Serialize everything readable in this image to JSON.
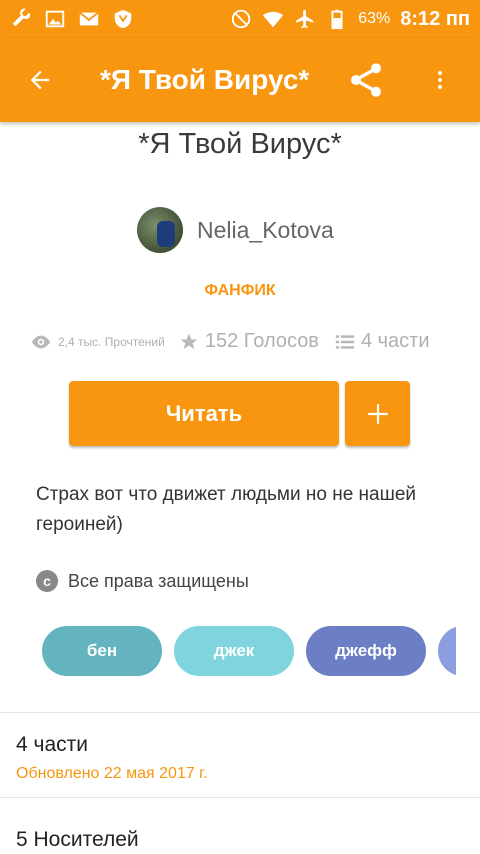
{
  "status_bar": {
    "battery": "63%",
    "time": "8:12 пп",
    "icons": [
      "wrench-icon",
      "image-icon",
      "gmail-icon",
      "shield-icon",
      "dnd-icon",
      "wifi-icon",
      "airplane-icon",
      "battery-icon"
    ]
  },
  "app_bar": {
    "title": "*Я Твой Вирус*",
    "back_icon": "arrow-left-icon",
    "share_icon": "share-icon",
    "more_icon": "more-vertical-icon"
  },
  "story": {
    "title": "*Я Твой Вирус*",
    "author": "Nelia_Kotova",
    "category": "ФАНФИК",
    "reads": "2,4 тыс. Прочтений",
    "votes": "152 Голосов",
    "parts": "4 части",
    "read_button": "Читать",
    "add_button": "+",
    "description": "Страх вот что движет людьми но не нашей героиней)",
    "copyright": "Все права защищены",
    "copyright_symbol": "c"
  },
  "tags": [
    {
      "label": "бен",
      "color": "#63b4be"
    },
    {
      "label": "джек",
      "color": "#7fd4de"
    },
    {
      "label": "джефф",
      "color": "#6c7ec4"
    },
    {
      "label": "",
      "color": "#8d9ee0"
    }
  ],
  "parts_section": {
    "title": "4 части",
    "updated": "Обновлено 22 мая 2017 г."
  },
  "carriers_section": {
    "title": "5 Носителей"
  },
  "colors": {
    "accent": "#f9960f",
    "text": "#333333",
    "muted": "#b0b0b0"
  }
}
